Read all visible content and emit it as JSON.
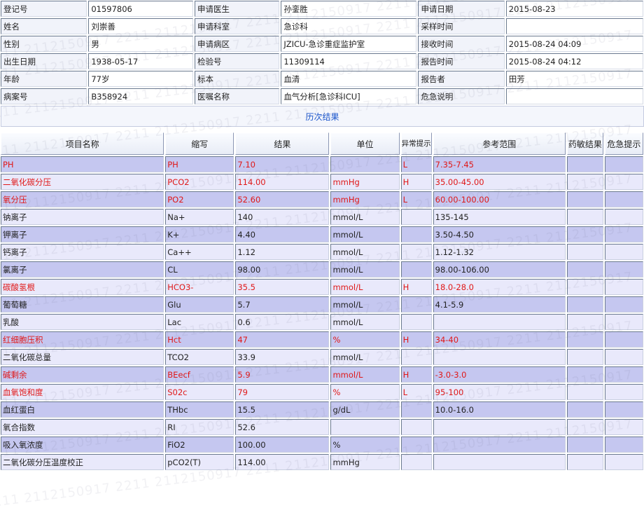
{
  "info": [
    {
      "l1": "登记号",
      "v1": "01597806",
      "l2": "申请医生",
      "v2": "孙銮胜",
      "l3": "申请日期",
      "v3": "2015-08-23"
    },
    {
      "l1": "姓名",
      "v1": "刘崇善",
      "l2": "申请科室",
      "v2": "急诊科",
      "l3": "采样时间",
      "v3": ""
    },
    {
      "l1": "性别",
      "v1": "男",
      "l2": "申请病区",
      "v2": "JZICU-急诊重症监护室",
      "l3": "接收时间",
      "v3": "2015-08-24 04:09"
    },
    {
      "l1": "出生日期",
      "v1": "1938-05-17",
      "l2": "检验号",
      "v2": "11309114",
      "l3": "报告时间",
      "v3": "2015-08-24 04:12"
    },
    {
      "l1": "年龄",
      "v1": "77岁",
      "l2": "标本",
      "v2": "血清",
      "l3": "报告者",
      "v3": "田芳"
    },
    {
      "l1": "病案号",
      "v1": "B358924",
      "l2": "医嘱名称",
      "v2": "血气分析[急诊科ICU]",
      "l3": "危急说明",
      "v3": ""
    }
  ],
  "history_link": "历次结果",
  "headers": {
    "name": "项目名称",
    "abbr": "缩写",
    "result": "结果",
    "unit": "单位",
    "flag": "异常提示",
    "ref": "参考范围",
    "drug": "药敏结果",
    "critical": "危急提示"
  },
  "rows": [
    {
      "name": "PH",
      "abbr": "PH",
      "result": "7.10",
      "unit": "",
      "flag": "L",
      "ref": "7.35-7.45",
      "abnormal": true
    },
    {
      "name": "二氧化碳分压",
      "abbr": "PCO2",
      "result": "114.00",
      "unit": "mmHg",
      "flag": "H",
      "ref": "35.00-45.00",
      "abnormal": true
    },
    {
      "name": "氧分压",
      "abbr": "PO2",
      "result": "52.60",
      "unit": "mmHg",
      "flag": "L",
      "ref": "60.00-100.00",
      "abnormal": true
    },
    {
      "name": "钠离子",
      "abbr": "Na+",
      "result": "140",
      "unit": "mmol/L",
      "flag": "",
      "ref": "135-145",
      "abnormal": false
    },
    {
      "name": "钾离子",
      "abbr": "K+",
      "result": "4.40",
      "unit": "mmol/L",
      "flag": "",
      "ref": "3.50-4.50",
      "abnormal": false
    },
    {
      "name": "钙离子",
      "abbr": "Ca++",
      "result": "1.12",
      "unit": "mmol/L",
      "flag": "",
      "ref": "1.12-1.32",
      "abnormal": false
    },
    {
      "name": "氯离子",
      "abbr": "CL",
      "result": "98.00",
      "unit": "mmol/L",
      "flag": "",
      "ref": "98.00-106.00",
      "abnormal": false
    },
    {
      "name": "碳酸氢根",
      "abbr": "HCO3-",
      "result": "35.5",
      "unit": "mmol/L",
      "flag": "H",
      "ref": "18.0-28.0",
      "abnormal": true
    },
    {
      "name": "葡萄糖",
      "abbr": "Glu",
      "result": "5.7",
      "unit": "mmol/L",
      "flag": "",
      "ref": "4.1-5.9",
      "abnormal": false
    },
    {
      "name": "乳酸",
      "abbr": "Lac",
      "result": "0.6",
      "unit": "mmol/L",
      "flag": "",
      "ref": "",
      "abnormal": false
    },
    {
      "name": "红细胞压积",
      "abbr": "Hct",
      "result": "47",
      "unit": "%",
      "flag": "H",
      "ref": "34-40",
      "abnormal": true
    },
    {
      "name": "二氧化碳总量",
      "abbr": "TCO2",
      "result": "33.9",
      "unit": "mmol/L",
      "flag": "",
      "ref": "",
      "abnormal": false
    },
    {
      "name": "碱剩余",
      "abbr": "BEecf",
      "result": "5.9",
      "unit": "mmol/L",
      "flag": "H",
      "ref": "-3.0-3.0",
      "abnormal": true
    },
    {
      "name": "血氧饱和度",
      "abbr": "S02c",
      "result": "79",
      "unit": "%",
      "flag": "L",
      "ref": "95-100",
      "abnormal": true
    },
    {
      "name": "血红蛋白",
      "abbr": "THbc",
      "result": "15.5",
      "unit": "g/dL",
      "flag": "",
      "ref": "10.0-16.0",
      "abnormal": false
    },
    {
      "name": "氧合指数",
      "abbr": "RI",
      "result": "52.6",
      "unit": "",
      "flag": "",
      "ref": "",
      "abnormal": false
    },
    {
      "name": "吸入氧浓度",
      "abbr": "FiO2",
      "result": "100.00",
      "unit": "%",
      "flag": "",
      "ref": "",
      "abnormal": false
    },
    {
      "name": "二氧化碳分压温度校正",
      "abbr": "pCO2(T)",
      "result": "114.00",
      "unit": "mmHg",
      "flag": "",
      "ref": "",
      "abnormal": false
    }
  ],
  "colors": {
    "abnormal_text": "#e01818",
    "row_odd": "#c5c7f0",
    "row_even": "#e9e9fb",
    "link": "#1a55cc"
  }
}
